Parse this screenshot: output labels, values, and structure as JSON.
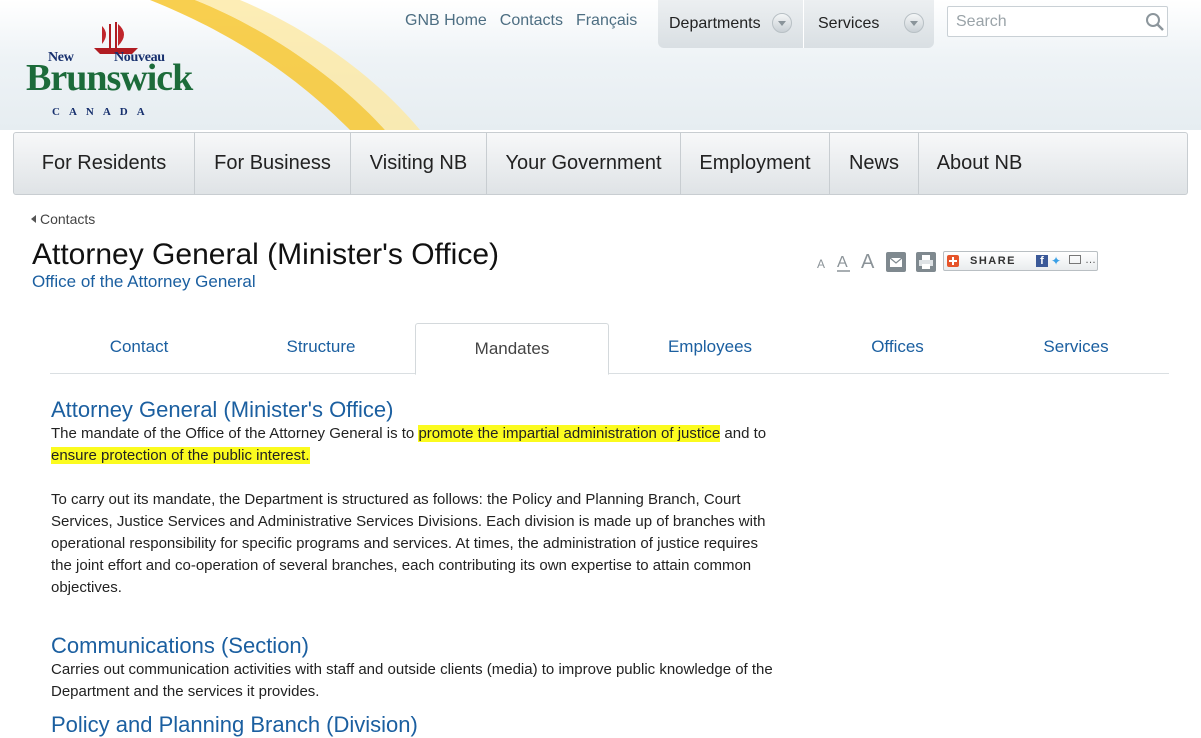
{
  "header": {
    "logo": {
      "new": "New",
      "nouveau": "Nouveau",
      "word": "Brunswick",
      "country": "CANADA"
    },
    "top_links": [
      "GNB Home",
      "Contacts",
      "Français"
    ],
    "dropdowns": [
      {
        "label": "Departments"
      },
      {
        "label": "Services"
      }
    ],
    "search": {
      "placeholder": "Search",
      "value": ""
    }
  },
  "main_nav": [
    "For Residents",
    "For Business",
    "Visiting NB",
    "Your Government",
    "Employment",
    "News",
    "About NB"
  ],
  "breadcrumb": {
    "label": "Contacts"
  },
  "page": {
    "title": "Attorney General (Minister's Office)",
    "subtitle": "Office of the Attorney General"
  },
  "tools": {
    "icons": [
      "text-small-icon",
      "text-medium-icon",
      "text-large-icon",
      "email-icon",
      "print-icon"
    ],
    "share_label": "SHARE"
  },
  "tabs": [
    {
      "label": "Contact",
      "active": false
    },
    {
      "label": "Structure",
      "active": false
    },
    {
      "label": "Mandates",
      "active": true
    },
    {
      "label": "Employees",
      "active": false
    },
    {
      "label": "Offices",
      "active": false
    },
    {
      "label": "Services",
      "active": false
    }
  ],
  "sections": [
    {
      "title": "Attorney General (Minister's Office)",
      "p1": {
        "a": "The mandate of the Office of the Attorney General is to ",
        "b": "promote the impartial administration of justice",
        "c": " and to ",
        "d": "ensure protection of the public interest."
      },
      "p2": "To carry out its mandate, the Department is structured as follows: the Policy and Planning Branch, Court Services, Justice Services and Administrative Services Divisions. Each division is made up of branches with operational responsibility for specific programs and services. At times, the administration of justice requires the joint effort and co-operation of several branches, each contributing its own expertise to attain common objectives."
    },
    {
      "title": "Communications (Section)",
      "p1": "Carries out communication activities with staff and outside clients (media) to improve public knowledge of the Department and the services it provides."
    },
    {
      "title": "Policy and Planning Branch (Division)"
    }
  ],
  "colors": {
    "link": "#1b5fa0",
    "highlight": "#fbfb1f",
    "logo_green": "#1c6b3a",
    "logo_navy": "#17306e"
  }
}
